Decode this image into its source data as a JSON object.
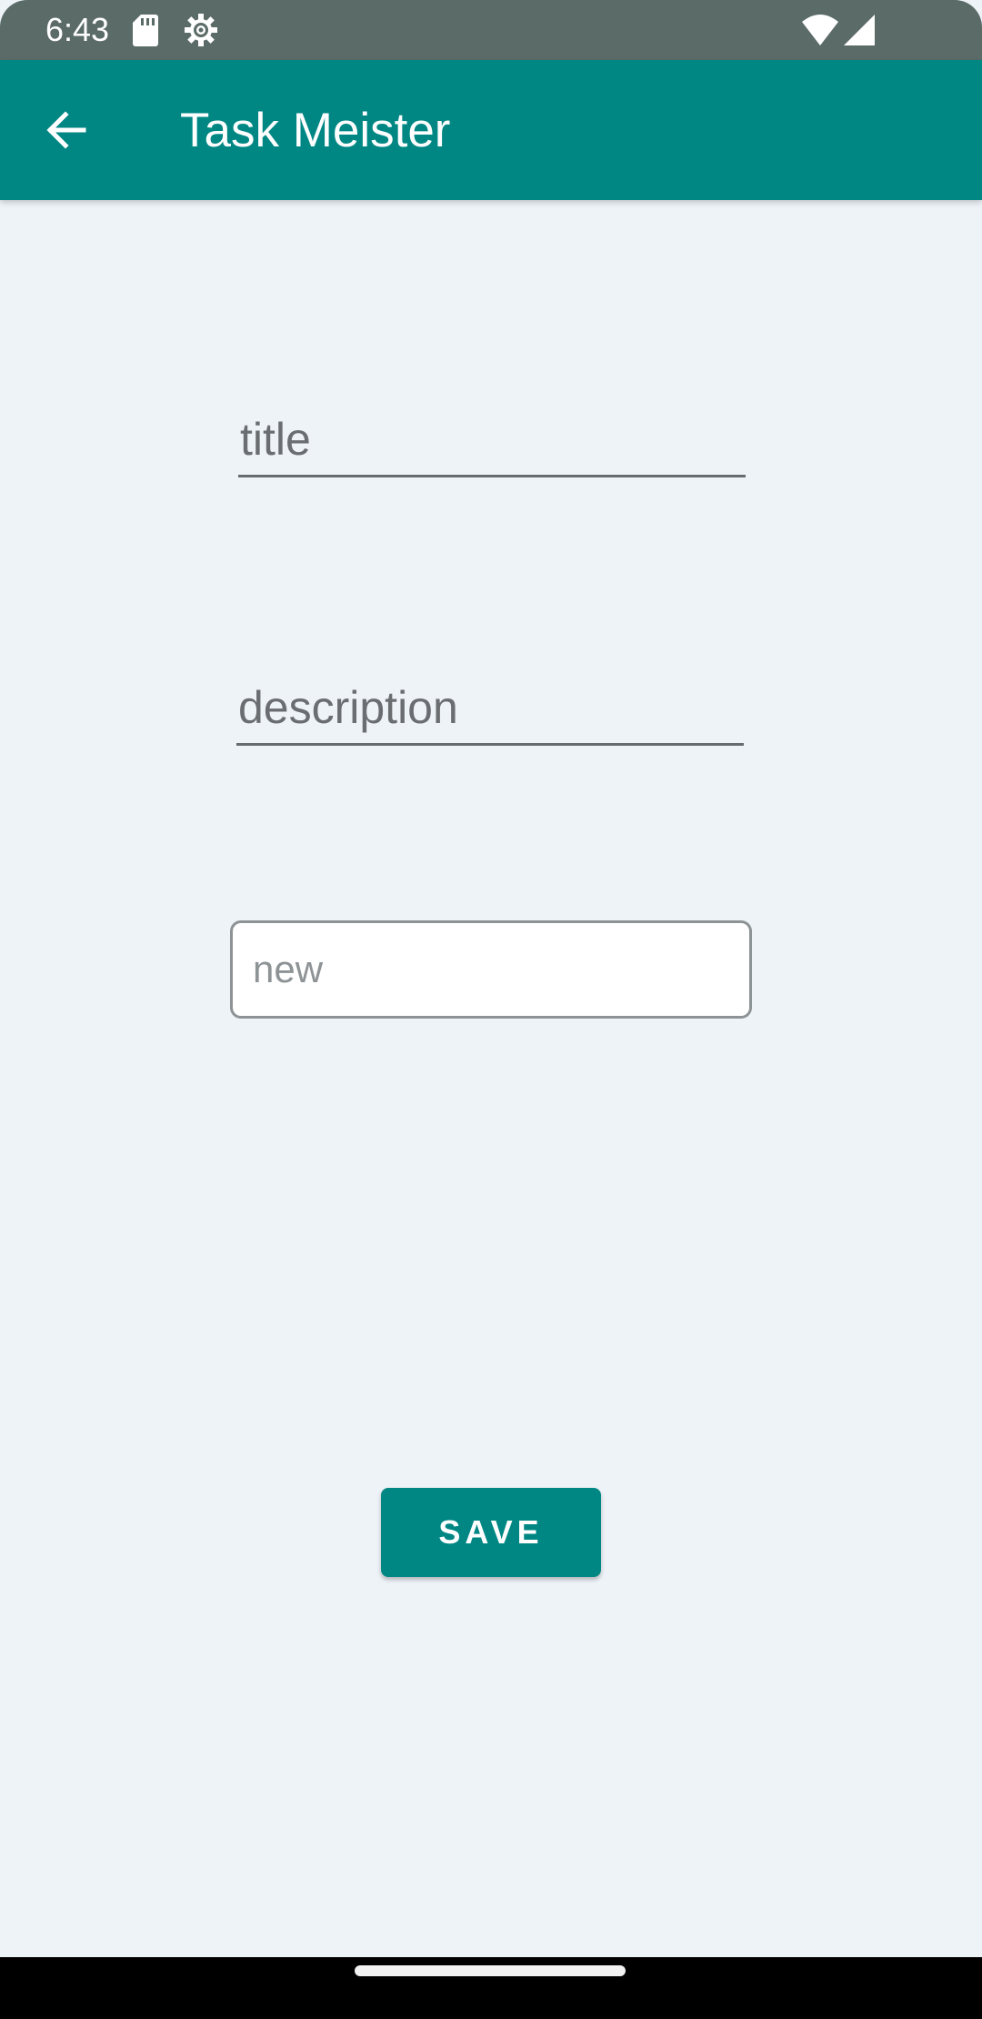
{
  "status_bar": {
    "time": "6:43",
    "icons": [
      "sd-card-icon",
      "settings-gear-icon",
      "wifi-icon",
      "signal-icon"
    ]
  },
  "app_bar": {
    "title": "Task Meister",
    "back_icon": "arrow-back-icon",
    "color": "#008784"
  },
  "form": {
    "title_placeholder": "title",
    "title_value": "",
    "description_placeholder": "description",
    "description_value": "",
    "status_selected": "new",
    "save_label": "SAVE"
  },
  "colors": {
    "background": "#eef3f8",
    "accent": "#008784",
    "status_bar": "#5b6b67"
  }
}
